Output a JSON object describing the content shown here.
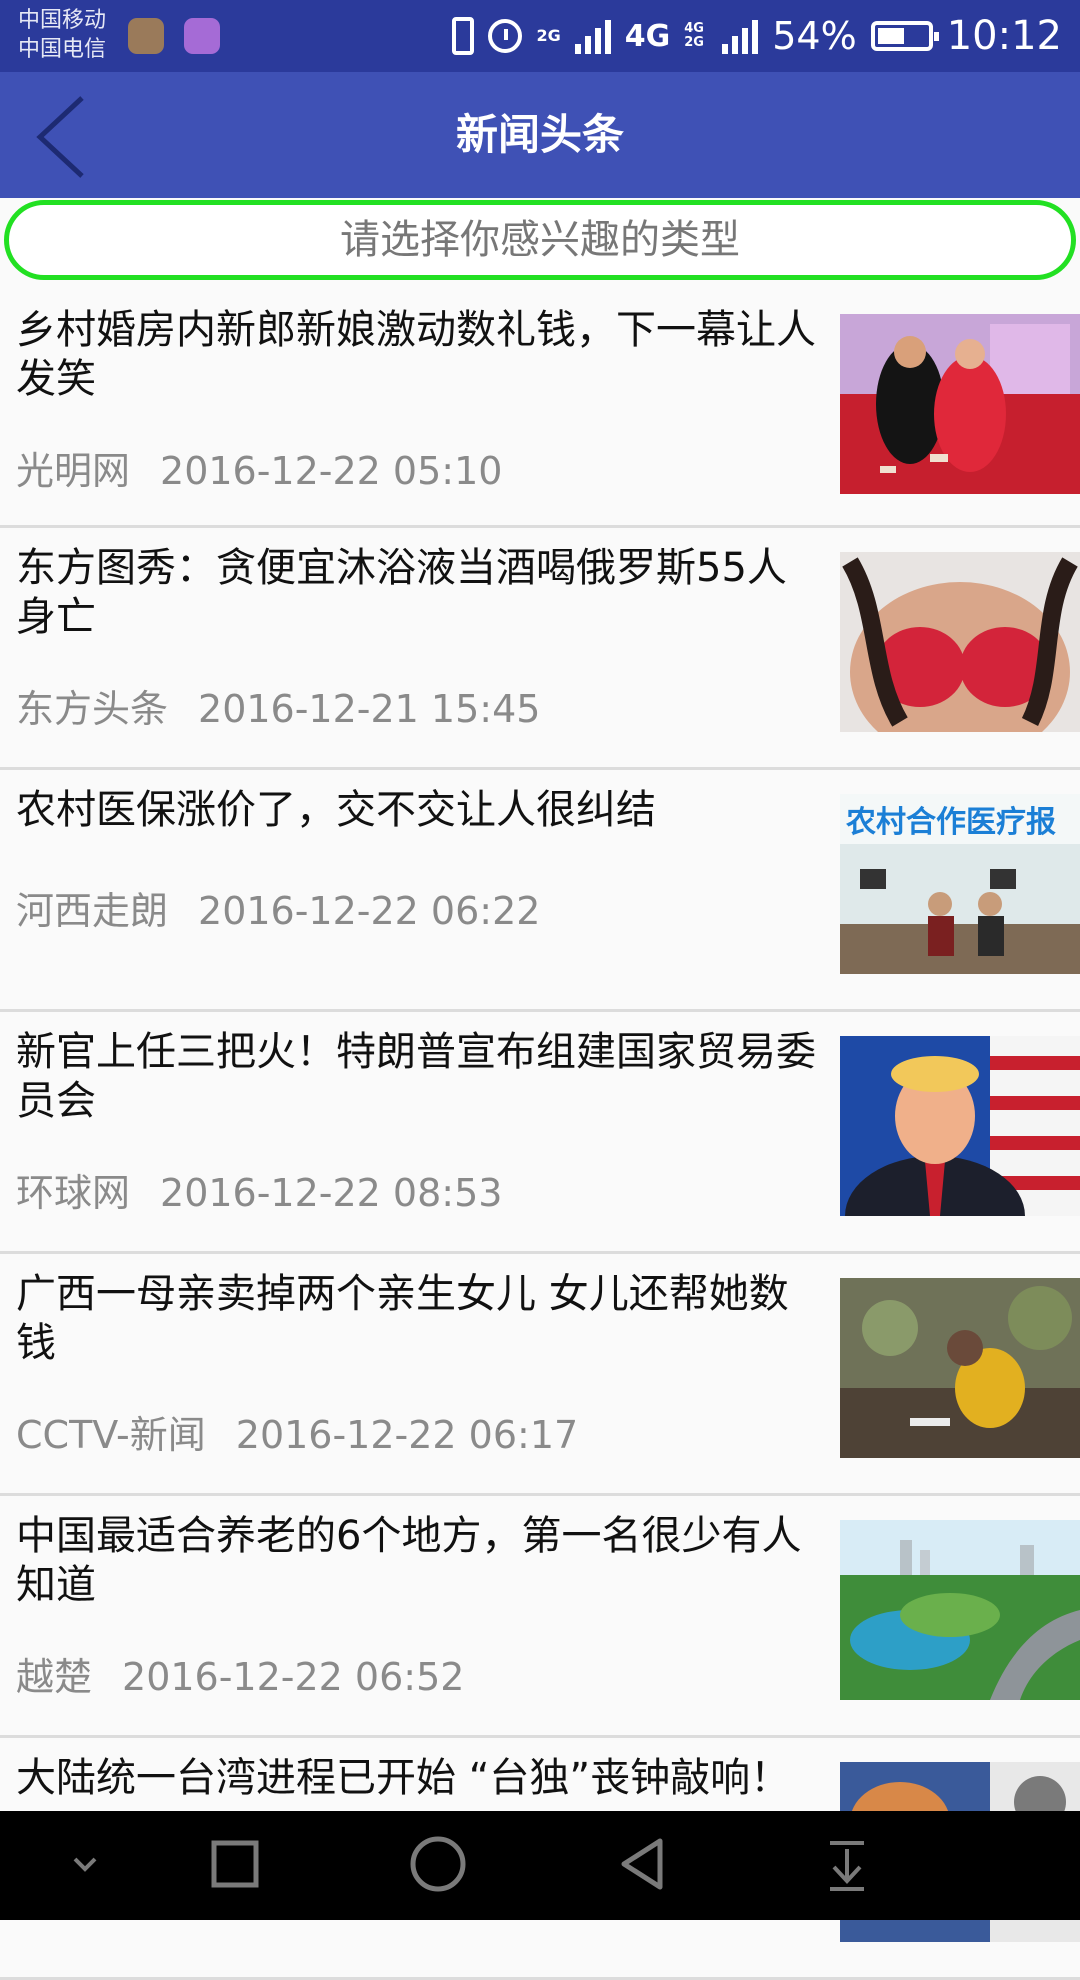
{
  "status_bar": {
    "carrier_1": "中国移动",
    "carrier_2": "中国电信",
    "net_2g": "2G",
    "net_4g": "4G",
    "net_4g_2g": "4G 2G",
    "battery_percent": "54%",
    "time": "10:12",
    "icons": [
      "vibrate-icon",
      "alarm-icon",
      "signal-icon",
      "battery-icon"
    ]
  },
  "app_bar": {
    "title": "新闻头条",
    "back_icon": "chevron-left-icon",
    "background": "#3f51b5"
  },
  "category_button": {
    "label": "请选择你感兴趣的类型",
    "border_color": "#22e022"
  },
  "news": [
    {
      "headline": "乡村婚房内新郎新娘激动数礼钱，下一幕让人发笑",
      "source": "光明网",
      "time": "2016-12-22 05:10"
    },
    {
      "headline": "东方图秀：贪便宜沐浴液当酒喝俄罗斯55人身亡",
      "source": "东方头条",
      "time": "2016-12-21 15:45"
    },
    {
      "headline": "农村医保涨价了，交不交让人很纠结",
      "source": "河西走朗",
      "time": "2016-12-22 06:22",
      "thumb_caption": "农村合作医疗报"
    },
    {
      "headline": "新官上任三把火！特朗普宣布组建国家贸易委员会",
      "source": "环球网",
      "time": "2016-12-22 08:53"
    },
    {
      "headline": "广西一母亲卖掉两个亲生女儿 女儿还帮她数钱",
      "source": "CCTV-新闻",
      "time": "2016-12-22 06:17"
    },
    {
      "headline": "中国最适合养老的6个地方，第一名很少有人知道",
      "source": "越楚",
      "time": "2016-12-22 06:52"
    },
    {
      "headline": "大陆统一台湾进程已开始 “台独”丧钟敲响！",
      "source": "",
      "time": ""
    }
  ],
  "nav_bar": {
    "icons": [
      "hide-keyboard-icon",
      "recent-apps-icon",
      "home-icon",
      "back-icon",
      "notification-pull-icon"
    ]
  }
}
